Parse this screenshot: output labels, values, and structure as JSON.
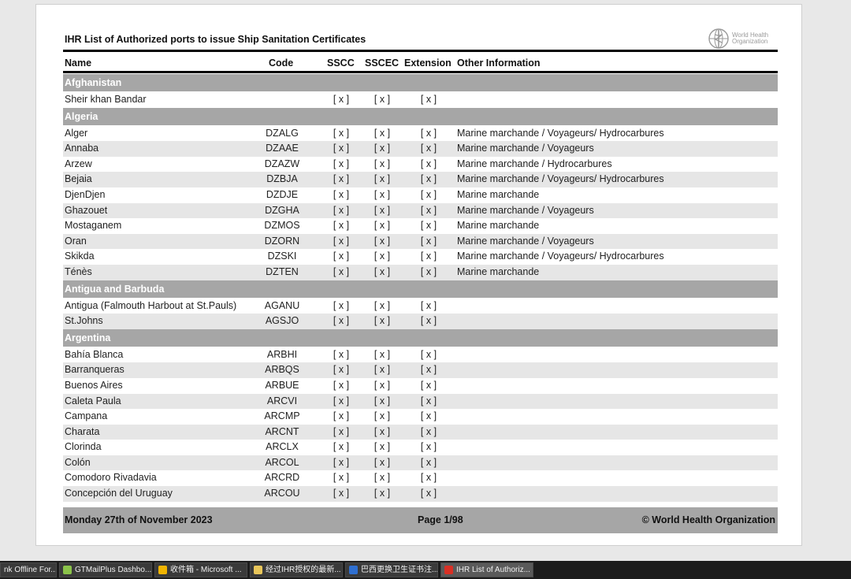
{
  "document": {
    "title": "IHR List of Authorized ports to issue Ship Sanitation Certificates",
    "logo_line1": "World Health",
    "logo_line2": "Organization",
    "headers": {
      "name": "Name",
      "code": "Code",
      "sscc": "SSCC",
      "sscec": "SSCEC",
      "extension": "Extension",
      "other": "Other Information"
    },
    "groups": [
      {
        "country": "Afghanistan",
        "rows": [
          {
            "name": "Sheir khan Bandar",
            "code": "",
            "sscc": "[ x ]",
            "sscec": "[ x ]",
            "ext": "[ x ]",
            "other": ""
          }
        ]
      },
      {
        "country": "Algeria",
        "rows": [
          {
            "name": "Alger",
            "code": "DZALG",
            "sscc": "[ x ]",
            "sscec": "[ x ]",
            "ext": "[ x ]",
            "other": "Marine marchande / Voyageurs/ Hydrocarbures"
          },
          {
            "name": "Annaba",
            "code": "DZAAE",
            "sscc": "[ x ]",
            "sscec": "[ x ]",
            "ext": "[ x ]",
            "other": "Marine marchande / Voyageurs"
          },
          {
            "name": "Arzew",
            "code": "DZAZW",
            "sscc": "[ x ]",
            "sscec": "[ x ]",
            "ext": "[ x ]",
            "other": "Marine marchande /  Hydrocarbures"
          },
          {
            "name": "Bejaia",
            "code": "DZBJA",
            "sscc": "[ x ]",
            "sscec": "[ x ]",
            "ext": "[ x ]",
            "other": "Marine marchande / Voyageurs/ Hydrocarbures"
          },
          {
            "name": "DjenDjen",
            "code": "DZDJE",
            "sscc": "[ x ]",
            "sscec": "[ x ]",
            "ext": "[ x ]",
            "other": "Marine marchande"
          },
          {
            "name": "Ghazouet",
            "code": "DZGHA",
            "sscc": "[ x ]",
            "sscec": "[ x ]",
            "ext": "[ x ]",
            "other": "Marine marchande / Voyageurs"
          },
          {
            "name": "Mostaganem",
            "code": "DZMOS",
            "sscc": "[ x ]",
            "sscec": "[ x ]",
            "ext": "[ x ]",
            "other": "Marine marchande"
          },
          {
            "name": "Oran",
            "code": "DZORN",
            "sscc": "[ x ]",
            "sscec": "[ x ]",
            "ext": "[ x ]",
            "other": "Marine marchande / Voyageurs"
          },
          {
            "name": "Skikda",
            "code": "DZSKI",
            "sscc": "[ x ]",
            "sscec": "[ x ]",
            "ext": "[ x ]",
            "other": "Marine marchande / Voyageurs/ Hydrocarbures"
          },
          {
            "name": "Ténès",
            "code": "DZTEN",
            "sscc": "[ x ]",
            "sscec": "[ x ]",
            "ext": "[ x ]",
            "other": "Marine marchande"
          }
        ]
      },
      {
        "country": "Antigua and Barbuda",
        "rows": [
          {
            "name": "Antigua (Falmouth Harbout at St.Pauls)",
            "code": "AGANU",
            "sscc": "[ x ]",
            "sscec": "[ x ]",
            "ext": "[ x ]",
            "other": ""
          },
          {
            "name": "St.Johns",
            "code": "AGSJO",
            "sscc": "[ x ]",
            "sscec": "[ x ]",
            "ext": "[ x ]",
            "other": ""
          }
        ]
      },
      {
        "country": "Argentina",
        "rows": [
          {
            "name": "Bahía Blanca",
            "code": "ARBHI",
            "sscc": "[ x ]",
            "sscec": "[ x ]",
            "ext": "[ x ]",
            "other": ""
          },
          {
            "name": "Barranqueras",
            "code": "ARBQS",
            "sscc": "[ x ]",
            "sscec": "[ x ]",
            "ext": "[ x ]",
            "other": ""
          },
          {
            "name": "Buenos Aires",
            "code": "ARBUE",
            "sscc": "[ x ]",
            "sscec": "[ x ]",
            "ext": "[ x ]",
            "other": ""
          },
          {
            "name": "Caleta Paula",
            "code": "ARCVI",
            "sscc": "[ x ]",
            "sscec": "[ x ]",
            "ext": "[ x ]",
            "other": ""
          },
          {
            "name": "Campana",
            "code": "ARCMP",
            "sscc": "[ x ]",
            "sscec": "[ x ]",
            "ext": "[ x ]",
            "other": ""
          },
          {
            "name": "Charata",
            "code": "ARCNT",
            "sscc": "[ x ]",
            "sscec": "[ x ]",
            "ext": "[ x ]",
            "other": ""
          },
          {
            "name": "Clorinda",
            "code": "ARCLX",
            "sscc": "[ x ]",
            "sscec": "[ x ]",
            "ext": "[ x ]",
            "other": ""
          },
          {
            "name": "Colón",
            "code": "ARCOL",
            "sscc": "[ x ]",
            "sscec": "[ x ]",
            "ext": "[ x ]",
            "other": ""
          },
          {
            "name": "Comodoro Rivadavia",
            "code": "ARCRD",
            "sscc": "[ x ]",
            "sscec": "[ x ]",
            "ext": "[ x ]",
            "other": ""
          },
          {
            "name": "Concepción del Uruguay",
            "code": "ARCOU",
            "sscc": "[ x ]",
            "sscec": "[ x ]",
            "ext": "[ x ]",
            "other": ""
          }
        ]
      }
    ],
    "footer": {
      "date": "Monday 27th of November 2023",
      "page": "Page 1/98",
      "copyright": "© World Health Organization"
    }
  },
  "taskbar": [
    {
      "label": "nk Offline For...",
      "icon": "generic-app-icon",
      "color": "#444444",
      "active": false
    },
    {
      "label": "GTMailPlus Dashbo...",
      "icon": "gtmail-icon",
      "color": "#8bc34a",
      "active": false
    },
    {
      "label": "收件箱 - Microsoft ...",
      "icon": "outlook-icon",
      "color": "#f0b400",
      "active": false
    },
    {
      "label": "经过IHR授权的最新...",
      "icon": "folder-icon",
      "color": "#e8c65a",
      "active": false
    },
    {
      "label": "巴西更换卫生证书注...",
      "icon": "browser-icon",
      "color": "#2f6fd0",
      "active": false
    },
    {
      "label": "IHR List of Authoriz...",
      "icon": "pdf-icon",
      "color": "#d93025",
      "active": true
    }
  ]
}
